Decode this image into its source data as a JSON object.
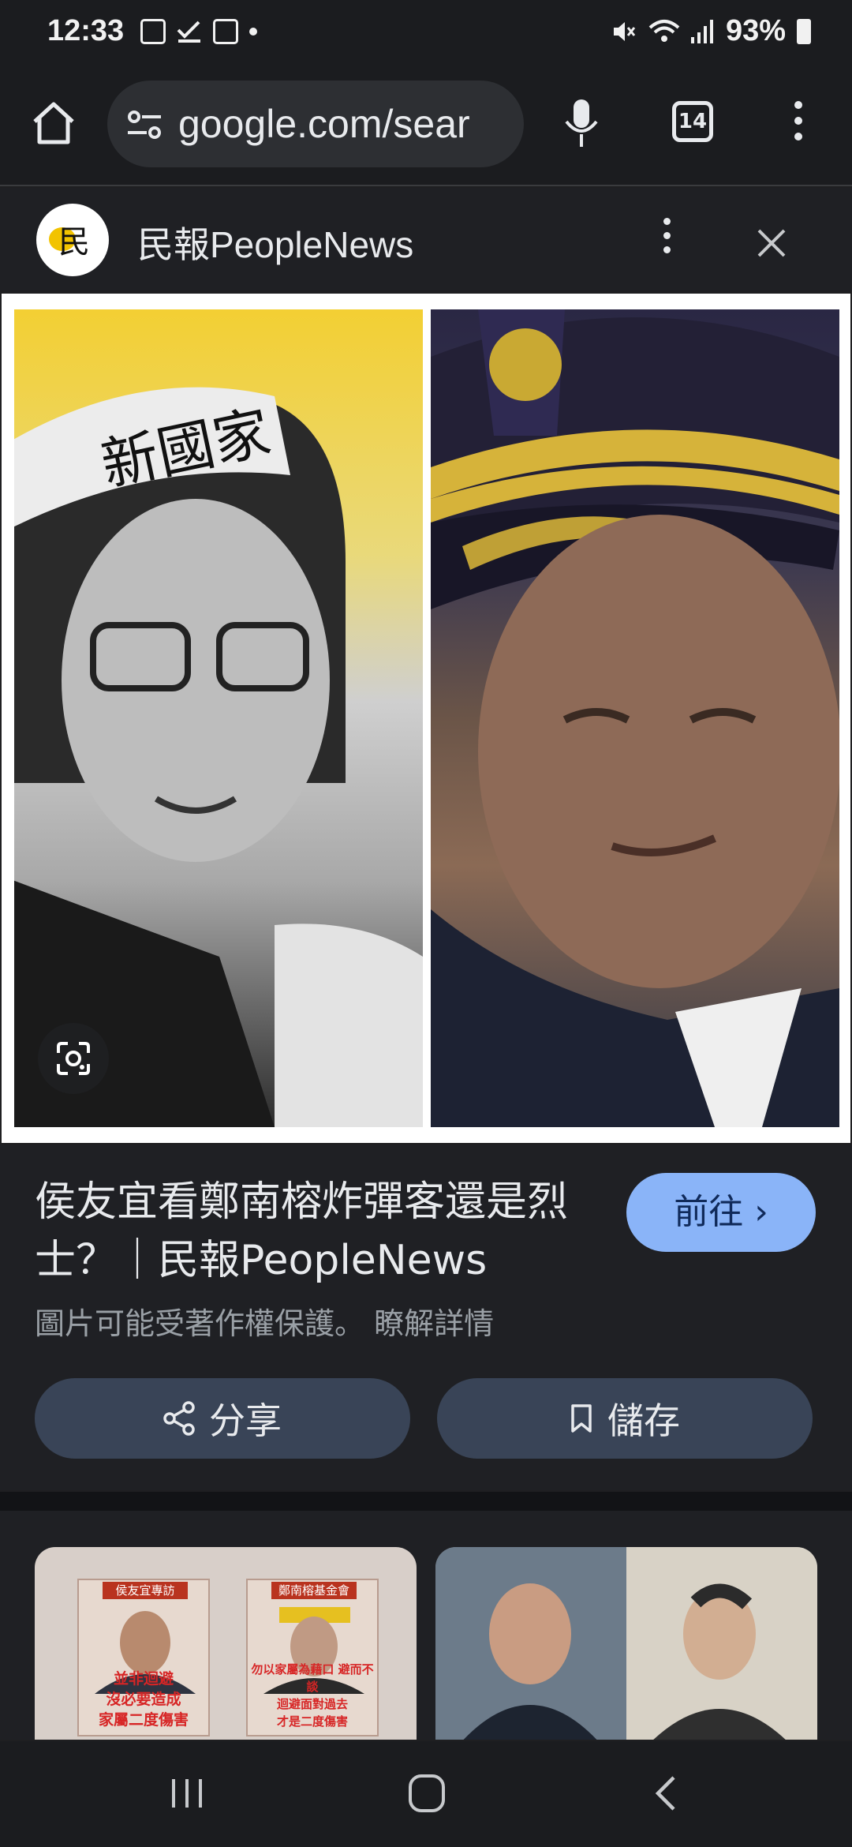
{
  "status_bar": {
    "time": "12:33",
    "battery": "93%",
    "icons": [
      "gallery-icon",
      "check-icon",
      "s-app-icon",
      "notification-dot",
      "mute-icon",
      "wifi-icon",
      "signal-icon",
      "battery-icon"
    ]
  },
  "browser": {
    "url": "google.com/sear",
    "tab_count": "14"
  },
  "source": {
    "logo_glyph": "民",
    "name": "民報PeopleNews"
  },
  "hero_image": {
    "headband_text": "新國家",
    "description_icons": [
      "google-lens-icon"
    ]
  },
  "result": {
    "title": "侯友宜看鄭南榕炸彈客還是烈士？｜民報PeopleNews",
    "visit_label": "前往 ›",
    "copyright_notice": "圖片可能受著作權保護。 瞭解詳情",
    "share_label": "分享",
    "save_label": "儲存"
  },
  "related": {
    "left_card": {
      "left_tag": "侯友宜專訪",
      "left_caption": "並非迴避\n沒必要造成\n家屬二度傷害",
      "right_tag": "鄭南榕基金會",
      "right_caption": "勿以家屬為藉口 避而不談\n迴避面對過去\n才是二度傷害"
    }
  },
  "colors": {
    "background": "#1f2024",
    "accent_button": "#8ab4f8",
    "action_button": "#394457"
  }
}
